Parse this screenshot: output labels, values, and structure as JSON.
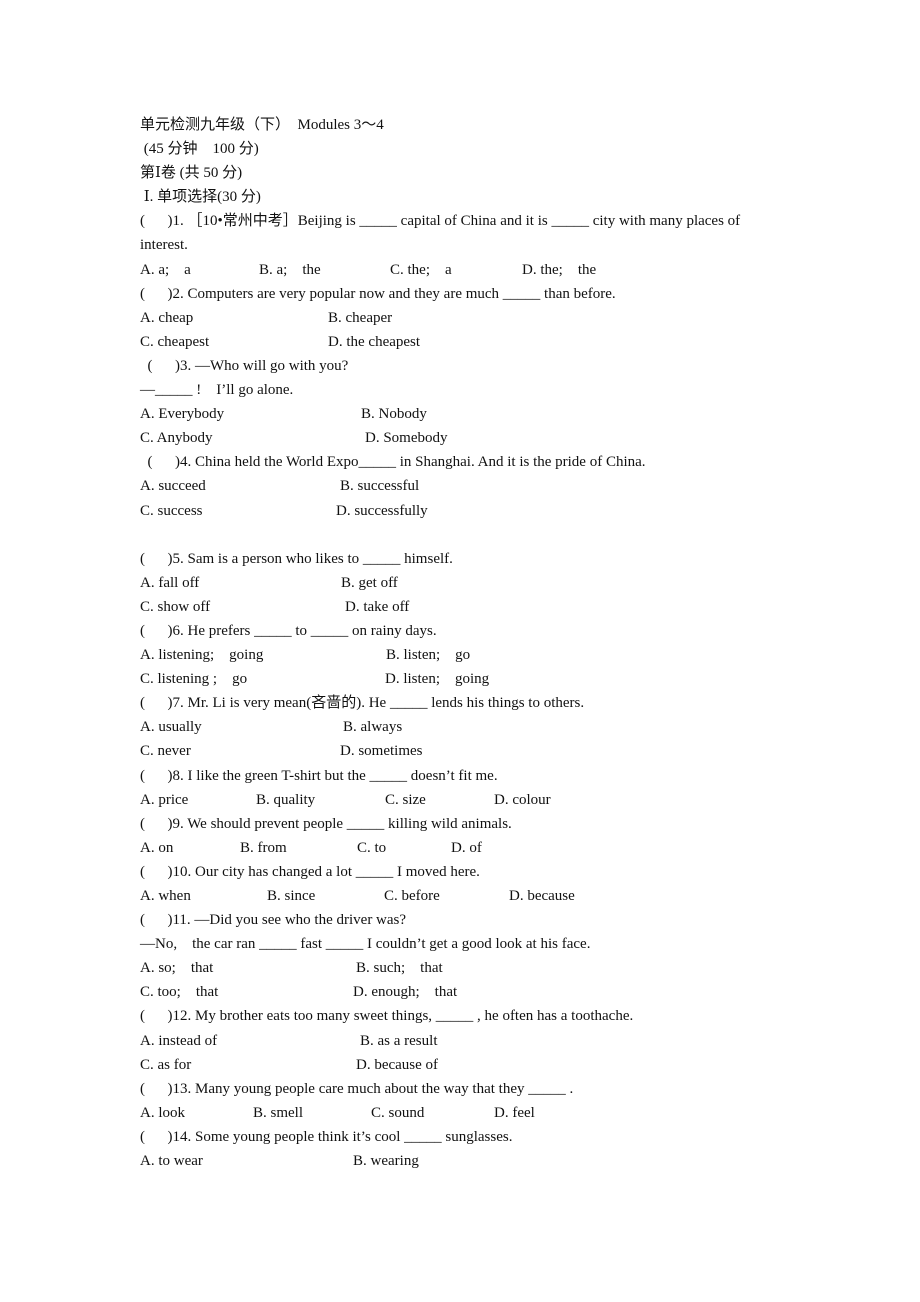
{
  "header": {
    "title": "单元检测九年级（下）  Modules 3～4",
    "time_score": " (45 分钟    100 分)",
    "part": "第Ⅰ卷 (共 50 分)",
    "section": " Ⅰ. 单项选择(30 分)"
  },
  "questions": [
    {
      "stem": "(      )1. ［10•常州中考］Beijing is _____ capital of China and it is _____ city with many places of",
      "stem_cont": "interest.",
      "options": [
        "A. a;    a",
        "B. a;    the",
        "C. the;    a",
        "D. the;    the"
      ]
    },
    {
      "stem": "(      )2. Computers are very popular now and they are much _____ than before.",
      "options": [
        "A. cheap",
        "B. cheaper",
        "C. cheapest",
        "D. the cheapest"
      ]
    },
    {
      "stem": "  (      )3. —Who will go with you?",
      "stem_cont": "—_____ !    I’ll go alone.",
      "options": [
        "A. Everybody",
        "B. Nobody",
        "C. Anybody",
        "D. Somebody"
      ]
    },
    {
      "stem": "  (      )4. China held the World Expo_____ in Shanghai. And it is the pride of China.",
      "options": [
        "A. succeed",
        "B. successful",
        "C. success",
        "D. successfully"
      ]
    },
    {
      "stem": "(      )5. Sam is a person who likes to _____ himself.",
      "options": [
        "A. fall off",
        "B. get off",
        "C. show off",
        "D. take off"
      ]
    },
    {
      "stem": "(      )6. He prefers _____ to _____ on rainy days.",
      "options": [
        "A. listening;    going",
        "B. listen;    go",
        "C. listening ;    go",
        "D. listen;    going"
      ]
    },
    {
      "stem": "(      )7. Mr. Li is very mean(吝啬的). He _____ lends his things to others.",
      "options": [
        "A. usually",
        "B. always",
        "C. never",
        "D. sometimes"
      ]
    },
    {
      "stem": "(      )8. I like the green T-shirt but the _____ doesn’t fit me.",
      "options": [
        "A. price",
        "B. quality",
        "C. size",
        "D. colour"
      ]
    },
    {
      "stem": "(      )9. We should prevent people _____ killing wild animals.",
      "options": [
        "A. on",
        "B. from",
        "C. to",
        "D. of"
      ]
    },
    {
      "stem": "(      )10. Our city has changed a lot _____ I moved here.",
      "options": [
        "A. when",
        "B. since",
        "C. before",
        "D. because"
      ]
    },
    {
      "stem": "(      )11. —Did you see who the driver was?",
      "stem_cont": "—No,    the car ran _____ fast _____ I couldn’t get a good look at his face.",
      "options": [
        "A. so;    that",
        "B. such;    that",
        "C. too;    that",
        "D. enough;    that"
      ]
    },
    {
      "stem": "(      )12. My brother eats too many sweet things, _____ , he often has a toothache.",
      "options": [
        "A. instead of",
        "B. as a result",
        "C. as for",
        "D. because of"
      ]
    },
    {
      "stem": "(      )13. Many young people care much about the way that they _____ .",
      "options": [
        "A. look",
        "B. smell",
        "C. sound",
        "D. feel"
      ]
    },
    {
      "stem": "(      )14. Some young people think it’s cool _____ sunglasses.",
      "options": [
        "A. to wear",
        "B. wearing"
      ]
    }
  ]
}
